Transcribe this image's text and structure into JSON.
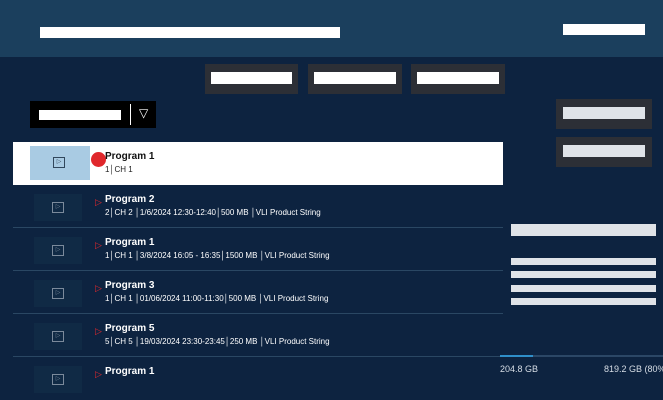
{
  "programs": [
    {
      "title": "Program 1",
      "meta": "1│CH 1",
      "status_icon": "record-dot"
    },
    {
      "title": "Program 2",
      "meta": "2│CH 2 │1/6/2024  12:30-12:40│500 MB │VLI Product String",
      "status_icon": "play-triangle-outline"
    },
    {
      "title": "Program 1",
      "meta": " 1│CH 1 │3/8/2024  16:05 - 16:35│1500 MB │VLI Product String",
      "status_icon": "play-triangle-outline"
    },
    {
      "title": "Program 3",
      "meta": "1│CH 1 │01/06/2024  11:00-11:30│500 MB │VLI Product String",
      "status_icon": "play-triangle-outline"
    },
    {
      "title": "Program 5",
      "meta": "5│CH 5 │19/03/2024  23:30-23:45│250 MB │VLI Product String",
      "status_icon": "play-triangle-outline"
    },
    {
      "title": "Program 1",
      "meta": "",
      "status_icon": "play-triangle-outline"
    }
  ],
  "storage": {
    "used": "204.8 GB",
    "free": "819.2 GB (80%)",
    "used_fraction": 0.2,
    "fill_color": "#2f8fc9"
  },
  "colors": {
    "background": "#0d2340",
    "header": "#1b3f5d",
    "record": "#e0282c",
    "selected_row": "#ffffff"
  }
}
